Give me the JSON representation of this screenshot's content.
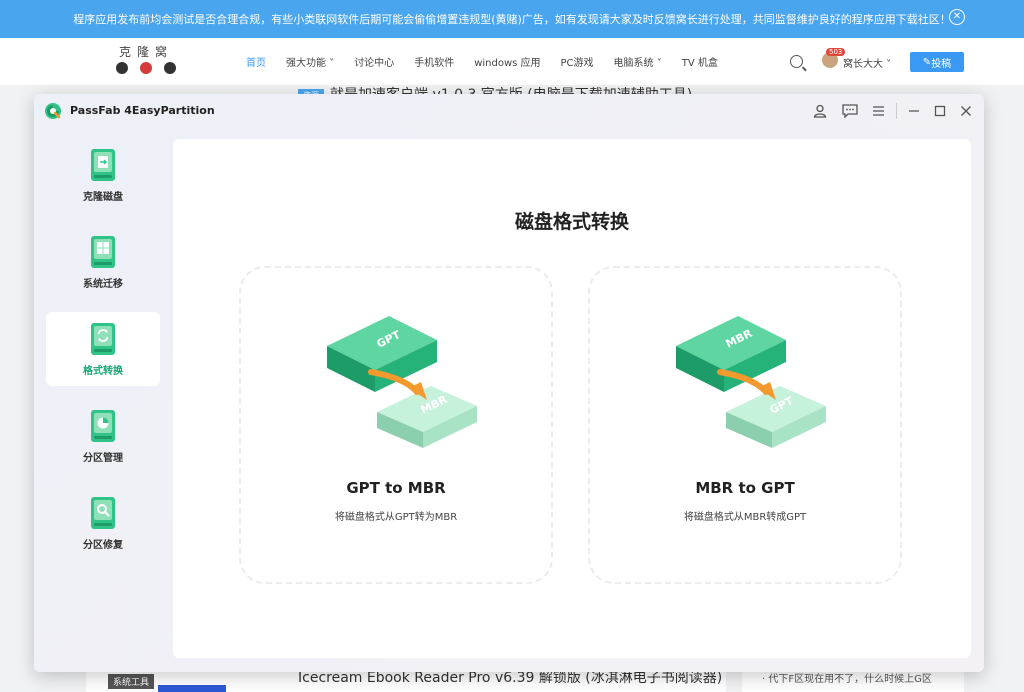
{
  "website": {
    "notice": "程序应用发布前均会测试是否合理合规，有些小类联网软件后期可能会偷偷增置违规型(黄赌)广告，如有发现请大家及时反馈窝长进行处理，共同监督维护良好的程序应用下载社区！",
    "logo_text": "克隆窝",
    "nav": [
      "首页",
      "强大功能",
      "讨论中心",
      "手机软件",
      "windows 应用",
      "PC游戏",
      "电脑系统",
      "TV 机盒"
    ],
    "badge": "503",
    "user": "窝长大大",
    "post_button": "投稿",
    "peek_top_tag": "资源",
    "peek_top": "就是加速客户端 v1.0.3 官方版 (电脑是下载加速辅助工具)",
    "peek_bottom": "Icecream Ebook Reader Pro v6.39 解锁版 (冰淇淋电子书阅读器)",
    "peek_right": "代下F区现在用不了，什么时候上G区",
    "tag_tools": "系统工具"
  },
  "app": {
    "title": "PassFab 4EasyPartition",
    "sidebar": [
      {
        "label": "克隆磁盘",
        "icon": "clone-disk-icon",
        "active": false
      },
      {
        "label": "系统迁移",
        "icon": "system-migrate-icon",
        "active": false
      },
      {
        "label": "格式转换",
        "icon": "format-convert-icon",
        "active": true
      },
      {
        "label": "分区管理",
        "icon": "partition-manage-icon",
        "active": false
      },
      {
        "label": "分区修复",
        "icon": "partition-repair-icon",
        "active": false
      }
    ],
    "panel_title": "磁盘格式转换",
    "cards": [
      {
        "title": "GPT to MBR",
        "desc": "将磁盘格式从GPT转为MBR",
        "from": "GPT",
        "to": "MBR"
      },
      {
        "title": "MBR to GPT",
        "desc": "将磁盘格式从MBR转成GPT",
        "from": "MBR",
        "to": "GPT"
      }
    ],
    "colors": {
      "accent": "#18a672",
      "disk_green": "#2fc388",
      "disk_light": "#8fe0b8",
      "arrow": "#f29a2e"
    }
  }
}
